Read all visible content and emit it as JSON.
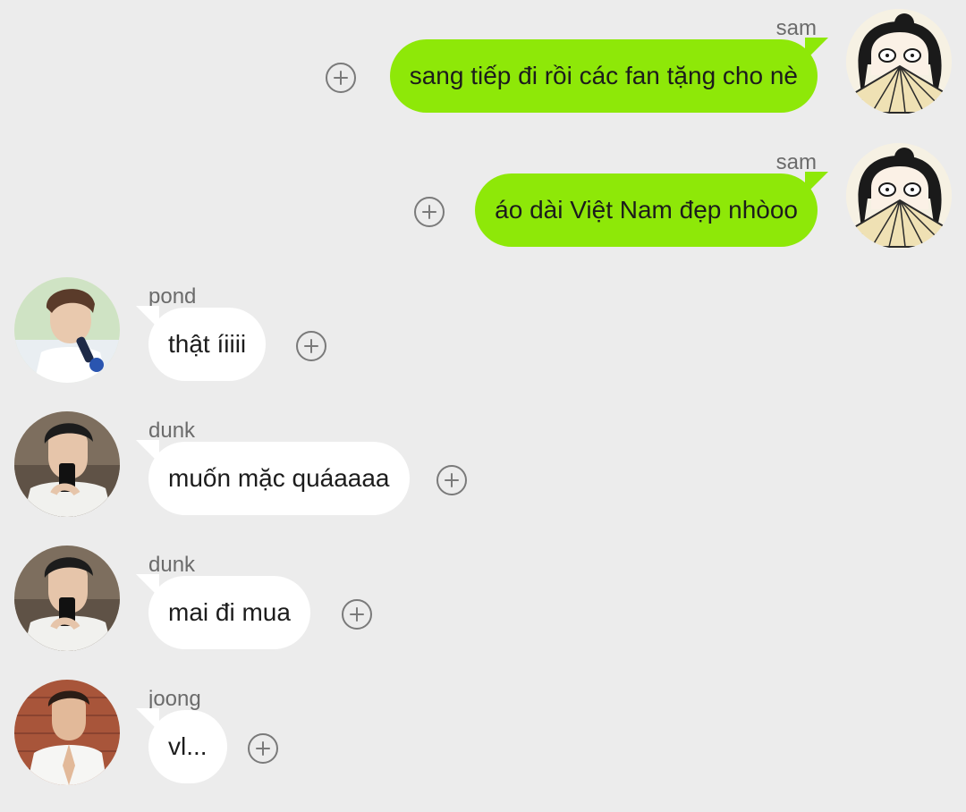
{
  "messages": [
    {
      "sender": "sam",
      "text": "sang tiếp đi rồi các fan tặng cho nè",
      "avatar": "cartoon-fan-avatar"
    },
    {
      "sender": "sam",
      "text": "áo dài Việt Nam đẹp nhòoo",
      "avatar": "cartoon-fan-avatar"
    },
    {
      "sender": "pond",
      "text": "thật íiiii",
      "avatar": "photo-pond-avatar"
    },
    {
      "sender": "dunk",
      "text": "muốn mặc quáaaaa",
      "avatar": "photo-dunk-avatar"
    },
    {
      "sender": "dunk",
      "text": "mai đi mua",
      "avatar": "photo-dunk-avatar"
    },
    {
      "sender": "joong",
      "text": "vl...",
      "avatar": "photo-joong-avatar"
    }
  ],
  "colors": {
    "background": "#ececec",
    "outgoing_bubble": "#8ee808",
    "incoming_bubble": "#ffffff",
    "name_text": "#6b6b6b",
    "add_reaction_icon": "#7a7a7a"
  },
  "icons": {
    "reaction": "add-reaction-icon"
  }
}
